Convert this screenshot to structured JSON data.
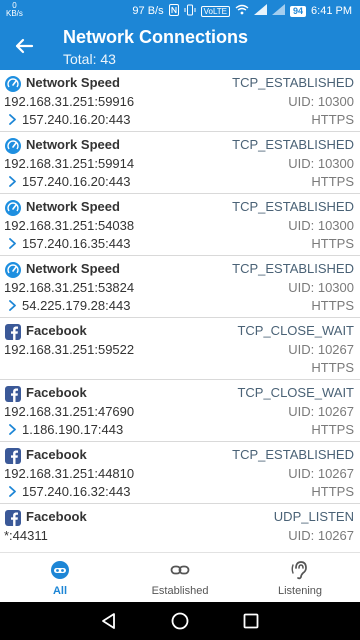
{
  "status_bar": {
    "left_top": "0",
    "left_bottom": "KB/s",
    "net_speed": "97 B/s",
    "volte": "VoLTE",
    "battery": "94",
    "time": "6:41 PM"
  },
  "header": {
    "title": "Network Connections",
    "subtitle": "Total: 43"
  },
  "connections": [
    {
      "app": "Network Speed",
      "icon": "speedometer-icon",
      "local": "192.168.31.251:59916",
      "remote": "157.240.16.20:443",
      "state": "TCP_ESTABLISHED",
      "uid": "UID: 10300",
      "protocol": "HTTPS"
    },
    {
      "app": "Network Speed",
      "icon": "speedometer-icon",
      "local": "192.168.31.251:59914",
      "remote": "157.240.16.20:443",
      "state": "TCP_ESTABLISHED",
      "uid": "UID: 10300",
      "protocol": "HTTPS"
    },
    {
      "app": "Network Speed",
      "icon": "speedometer-icon",
      "local": "192.168.31.251:54038",
      "remote": "157.240.16.35:443",
      "state": "TCP_ESTABLISHED",
      "uid": "UID: 10300",
      "protocol": "HTTPS"
    },
    {
      "app": "Network Speed",
      "icon": "speedometer-icon",
      "local": "192.168.31.251:53824",
      "remote": "54.225.179.28:443",
      "state": "TCP_ESTABLISHED",
      "uid": "UID: 10300",
      "protocol": "HTTPS"
    },
    {
      "app": "Facebook",
      "icon": "facebook-icon",
      "local": "192.168.31.251:59522",
      "remote": "",
      "state": "TCP_CLOSE_WAIT",
      "uid": "UID: 10267",
      "protocol": "HTTPS"
    },
    {
      "app": "Facebook",
      "icon": "facebook-icon",
      "local": "192.168.31.251:47690",
      "remote": "1.186.190.17:443",
      "state": "TCP_CLOSE_WAIT",
      "uid": "UID: 10267",
      "protocol": "HTTPS"
    },
    {
      "app": "Facebook",
      "icon": "facebook-icon",
      "local": "192.168.31.251:44810",
      "remote": "157.240.16.32:443",
      "state": "TCP_ESTABLISHED",
      "uid": "UID: 10267",
      "protocol": "HTTPS"
    },
    {
      "app": "Facebook",
      "icon": "facebook-icon",
      "local": "*:44311",
      "remote": "",
      "state": "UDP_LISTEN",
      "uid": "UID: 10267",
      "protocol": ""
    }
  ],
  "bottom_nav": [
    {
      "label": "All",
      "icon": "all-icon",
      "active": true
    },
    {
      "label": "Established",
      "icon": "link-icon",
      "active": false
    },
    {
      "label": "Listening",
      "icon": "ear-icon",
      "active": false
    }
  ],
  "colors": {
    "primary": "#1d86d6",
    "facebook": "#3b5998"
  }
}
